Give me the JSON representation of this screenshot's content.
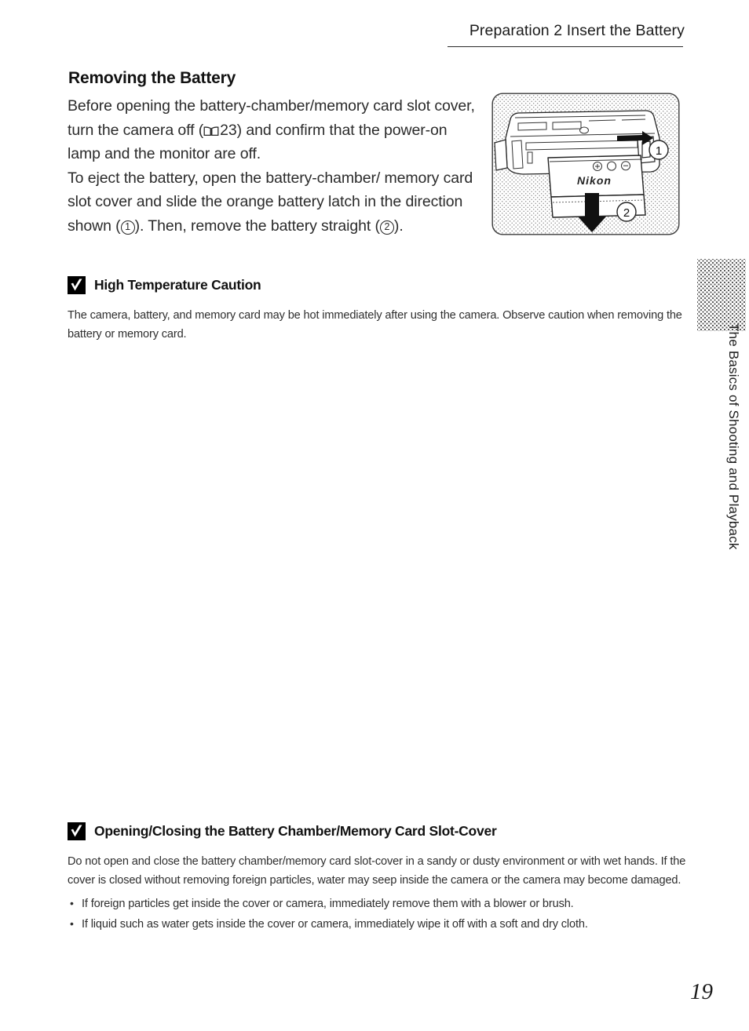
{
  "header": {
    "running_head": "Preparation 2 Insert the Battery"
  },
  "section": {
    "title": "Removing the Battery",
    "paragraph1_part1": "Before opening the battery-chamber/memory card slot cover, turn the camera off (",
    "paragraph1_ref": "23",
    "paragraph1_part2": ") and confirm that the power-on lamp and the monitor are off.",
    "paragraph2_part1": "To eject the battery, open the battery-chamber/ memory card slot cover and slide the orange battery latch in the direction shown (",
    "paragraph2_circle1": "1",
    "paragraph2_part2": "). Then, remove the battery straight (",
    "paragraph2_circle2": "2",
    "paragraph2_part3": ")."
  },
  "figure": {
    "alt": "Camera bottom with battery-chamber cover open and battery ejecting",
    "battery_brand": "Nikon",
    "callout_1": "1",
    "callout_2": "2"
  },
  "caution1": {
    "title": "High Temperature Caution",
    "body": "The camera, battery, and memory card may be hot immediately after using the camera. Observe caution when removing the battery or memory card."
  },
  "caution2": {
    "title": "Opening/Closing the Battery Chamber/Memory Card Slot-Cover",
    "body": "Do not open and close the battery chamber/memory card slot-cover in a sandy or dusty environment or with wet hands. If the cover is closed without removing foreign particles, water may seep inside the camera or the camera may become damaged.",
    "bullets": [
      "If foreign particles get inside the cover or camera, immediately remove them with a blower or brush.",
      "If liquid such as water gets inside the cover or camera, immediately wipe it off with a soft and dry cloth."
    ]
  },
  "margin": {
    "chapter_label": "The Basics of Shooting and Playback"
  },
  "footer": {
    "page_number": "19"
  }
}
